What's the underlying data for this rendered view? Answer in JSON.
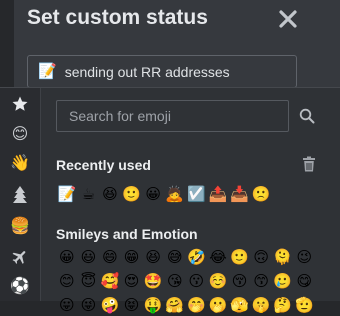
{
  "modal": {
    "title": "Set custom status",
    "close_glyph": "✕",
    "status_emoji": "📝",
    "status_text": "sending out RR addresses"
  },
  "picker": {
    "categories": [
      {
        "icon": "star-icon",
        "glyph": "★"
      },
      {
        "icon": "smiley-icon",
        "glyph": "😊"
      },
      {
        "icon": "waving-hand-icon",
        "glyph": "👋"
      },
      {
        "icon": "tree-icon",
        "glyph": "🌲"
      },
      {
        "icon": "burger-icon",
        "glyph": "🍔"
      },
      {
        "icon": "airplane-icon",
        "glyph": "✈"
      },
      {
        "icon": "soccer-ball-icon",
        "glyph": "⚽"
      }
    ],
    "search_placeholder": "Search for emoji",
    "recently_used_title": "Recently used",
    "recently_used": [
      "📝",
      "☕",
      "😆",
      "🙂",
      "😀",
      "🙇",
      "☑️",
      "📤",
      "📥",
      "🙁"
    ],
    "smileys_title": "Smileys and Emotion",
    "smileys_rows": [
      [
        "😀",
        "😃",
        "😄",
        "😁",
        "😆",
        "😅",
        "🤣",
        "😂",
        "🙂",
        "🙃",
        "🫠",
        "😉"
      ],
      [
        "😊",
        "😇",
        "🥰",
        "😍",
        "🤩",
        "😘",
        "😗",
        "☺️",
        "😚",
        "😙",
        "🥲",
        "😋"
      ],
      [
        "😛",
        "😜",
        "🤪",
        "😝",
        "🤑",
        "🤗",
        "🤭",
        "🫢",
        "🫣",
        "🤫",
        "🤔",
        "🫡"
      ]
    ]
  },
  "colors": {
    "modal_bg": "#36393e",
    "picker_bg": "#2f3236",
    "text": "#e6e8eb"
  }
}
